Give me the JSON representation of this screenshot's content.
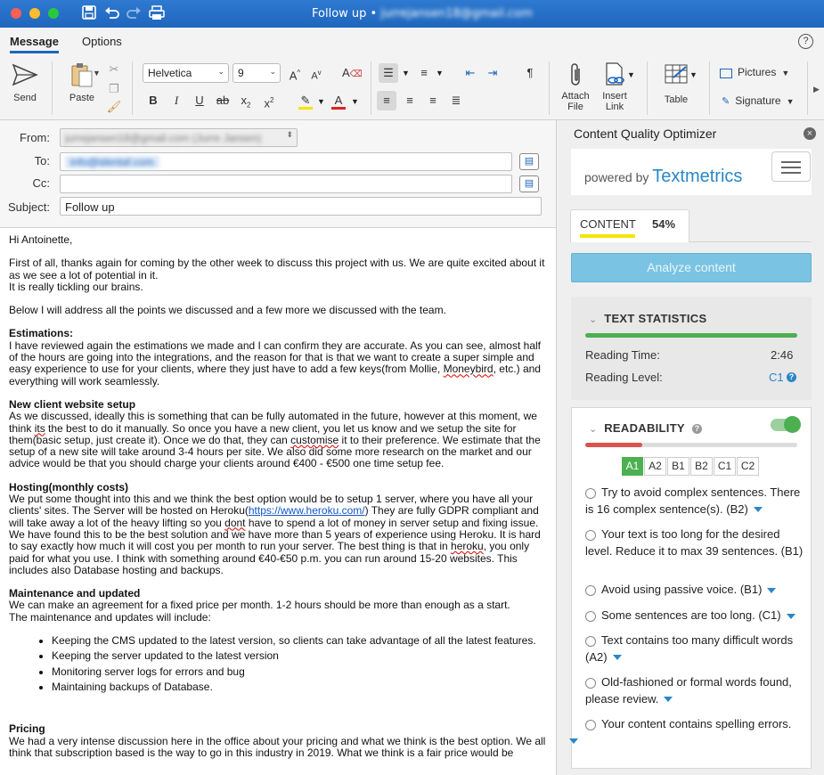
{
  "window": {
    "title": "Follow up",
    "title_sep": " • ",
    "account": "jurrejansen18@gmail.com"
  },
  "tabs": [
    "Message",
    "Options"
  ],
  "ribbon": {
    "send": "Send",
    "paste": "Paste",
    "font": "Helvetica",
    "size": "9",
    "attach": [
      "Attach",
      "File"
    ],
    "insert_link": [
      "Insert",
      "Link"
    ],
    "table": "Table",
    "pictures": "Pictures",
    "signature": "Signature"
  },
  "header": {
    "from_label": "From:",
    "from_value": "jurrejansen18@gmail.com (Jurre Jansen)",
    "to_label": "To:",
    "to_value": "info@identaf.com",
    "cc_label": "Cc:",
    "cc_value": "",
    "subject_label": "Subject:",
    "subject_value": "Follow up"
  },
  "email": {
    "greeting": "Hi Antoinette,",
    "p1": "First of all, thanks again for coming by the other week to discuss this project with us. We are quite excited about it as we see a lot of potential in it.",
    "p1b": "It is really tickling our brains.",
    "p2": "Below I will address all the points we discussed and a few more we discussed with the team.",
    "h_est": "Estimations:",
    "est_a": "I have reviewed again the estimations we made and I can confirm they are accurate. As you can see, almost half of the hours are going into the integrations, and the reason for that is that we want to create a super simple and easy experience to use for your clients, where they just have to add a few keys(from Mollie, ",
    "est_moneybird": "Moneybird",
    "est_b": ", etc.) and everything will work seamlessly.",
    "h_new": "New client website setup",
    "new_a": "As we discussed, ideally this is something that can be fully automated in the future, however at this moment, we think ",
    "new_its": "its",
    "new_b": " the best to do it manually. So once you have a new client, you let us know and we setup the site for them(basic setup, just create it). Once we do that, they can ",
    "new_customise": "customise",
    "new_c": " it to their preference. We estimate that the setup of a new site will take around 3-4 hours per site. We also did some more research on the market and our advice would be that you should charge your clients around €400 - €500 one time setup fee.",
    "h_host": "Hosting(monthly costs)",
    "host_a": "We put some thought into this and we think the best option would be to setup 1 server, where you have all your clients' sites. The Server will be hosted on Heroku(",
    "host_link": "https://www.heroku.com/",
    "host_b": ") They are fully GDPR compliant and will take away a lot of the heavy lifting so you ",
    "host_dont": "dont",
    "host_c": " have to spend a lot of money in server setup and fixing issue. We have found this to be the best solution and we have more than 5 years of experience using Heroku. It is hard to say exactly how much it will cost you per month to run your server. The best thing is that in ",
    "host_heroku": "heroku",
    "host_d": ", you only paid for what you use. I think with something around €40-€50 p.m. you can run around 15-20 websites. This includes also Database hosting and backups.",
    "h_maint": "Maintenance and updated",
    "maint_a": "We can make an agreement for a fixed price per month. 1-2 hours should be more than enough as a start.",
    "maint_b": "The maintenance and updates will include:",
    "bullets": [
      "Keeping the CMS updated to the latest version, so clients can take advantage of all the latest features.",
      "Keeping the server updated to the latest version",
      "Monitoring server logs for errors and bug",
      "Maintaining backups of Database."
    ],
    "h_pricing": "Pricing",
    "pricing": "We had a very intense discussion here in the office about your pricing and what we think is the best option. We all think that subscription based is the way to go in this industry in 2019. What we think is a fair price would be"
  },
  "pane": {
    "title": "Content Quality Optimizer",
    "powered_by": "powered by",
    "brand": "Textmetrics",
    "content_tab": "CONTENT",
    "content_score": "54%",
    "content_score_fraction": 0.54,
    "analyze": "Analyze content",
    "text_stats": {
      "heading": "TEXT STATISTICS",
      "reading_time_label": "Reading Time:",
      "reading_time": "2:46",
      "reading_level_label": "Reading Level:",
      "reading_level": "C1"
    },
    "readability": {
      "heading": "READABILITY",
      "toggle_on": true,
      "score_fraction": 0.27,
      "levels": [
        "A1",
        "A2",
        "B1",
        "B2",
        "C1",
        "C2"
      ],
      "active_level": "A1",
      "issues": [
        "Try to avoid complex sentences. There is 16 complex sentence(s). (B2)",
        "Your text is too long for the desired level. Reduce it to max 39 sentences. (B1)",
        "Avoid using passive voice. (B1)",
        "Some sentences are too long. (C1)",
        "Text contains too many difficult words (A2)",
        "Old-fashioned or formal words found, please review.",
        "Your content contains spelling errors."
      ]
    }
  },
  "colors": {
    "accent": "#1f66bd",
    "green": "#4cb050",
    "red": "#d9534f",
    "analyze": "#7ac3e2",
    "yellow": "#f5e500"
  }
}
